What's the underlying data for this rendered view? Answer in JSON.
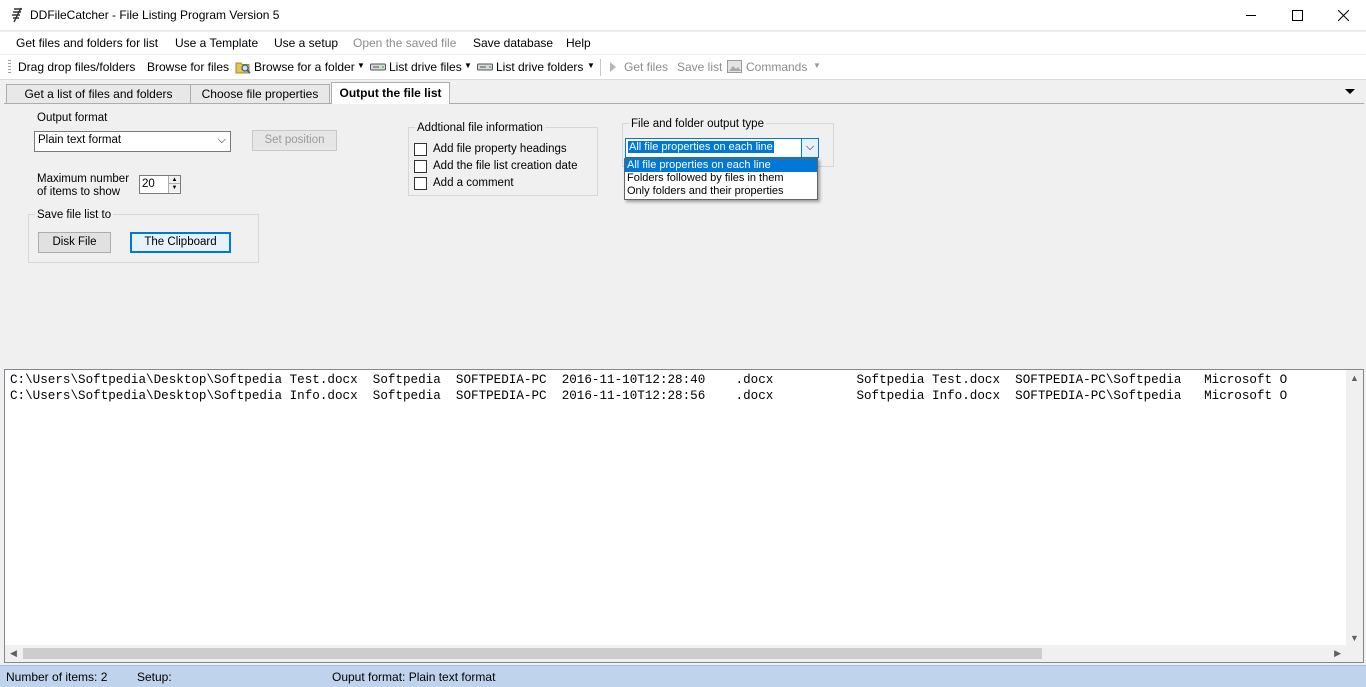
{
  "window": {
    "title": "DDFileCatcher - File Listing Program Version 5"
  },
  "menu": {
    "items": [
      {
        "label": "Get files and folders for list",
        "enabled": true
      },
      {
        "label": "Use a Template",
        "enabled": true
      },
      {
        "label": "Use a setup",
        "enabled": true
      },
      {
        "label": "Open the saved file",
        "enabled": false
      },
      {
        "label": "Save database",
        "enabled": true
      },
      {
        "label": "Help",
        "enabled": true
      }
    ]
  },
  "toolbar": {
    "drag_drop": "Drag drop files/folders",
    "browse_files": "Browse for files",
    "browse_folder": "Browse for a folder",
    "list_drive_files": "List drive files",
    "list_drive_folders": "List drive folders",
    "get_files": "Get files",
    "save_list": "Save list",
    "commands": "Commands"
  },
  "tabs": [
    {
      "label": "Get a list of files and folders",
      "active": false
    },
    {
      "label": "Choose file properties",
      "active": false
    },
    {
      "label": "Output the file list",
      "active": true
    }
  ],
  "output_panel": {
    "output_format_label": "Output format",
    "output_format_value": "Plain text format",
    "set_position_label": "Set position",
    "max_items_label_line1": "Maximum number",
    "max_items_label_line2": "of items to show",
    "max_items_value": "20",
    "save_group_title": "Save file list to",
    "disk_file_label": "Disk File",
    "clipboard_label": "The Clipboard",
    "additional_info_title": "Addtional file information",
    "checkboxes": [
      {
        "label": "Add file property headings",
        "checked": false
      },
      {
        "label": "Add the file list creation date",
        "checked": false
      },
      {
        "label": "Add a comment",
        "checked": false
      }
    ],
    "output_type_title": "File and folder output type",
    "output_type_value": "All file properties on each line",
    "output_type_options": [
      {
        "label": "All file properties on each line",
        "selected": true
      },
      {
        "label": "Folders followed by files in them",
        "selected": false
      },
      {
        "label": "Only folders and their properties",
        "selected": false
      }
    ]
  },
  "file_list": {
    "lines": [
      "C:\\Users\\Softpedia\\Desktop\\Softpedia Test.docx  Softpedia  SOFTPEDIA-PC  2016-11-10T12:28:40    .docx           Softpedia Test.docx  SOFTPEDIA-PC\\Softpedia   Microsoft O",
      "C:\\Users\\Softpedia\\Desktop\\Softpedia Info.docx  Softpedia  SOFTPEDIA-PC  2016-11-10T12:28:56    .docx           Softpedia Info.docx  SOFTPEDIA-PC\\Softpedia   Microsoft O"
    ]
  },
  "status": {
    "items_count": "Number of items: 2",
    "setup": "Setup:",
    "output_format": "Ouput format: Plain text format"
  },
  "colors": {
    "accent": "#0078d7",
    "status_bar": "#bfd4ec"
  }
}
